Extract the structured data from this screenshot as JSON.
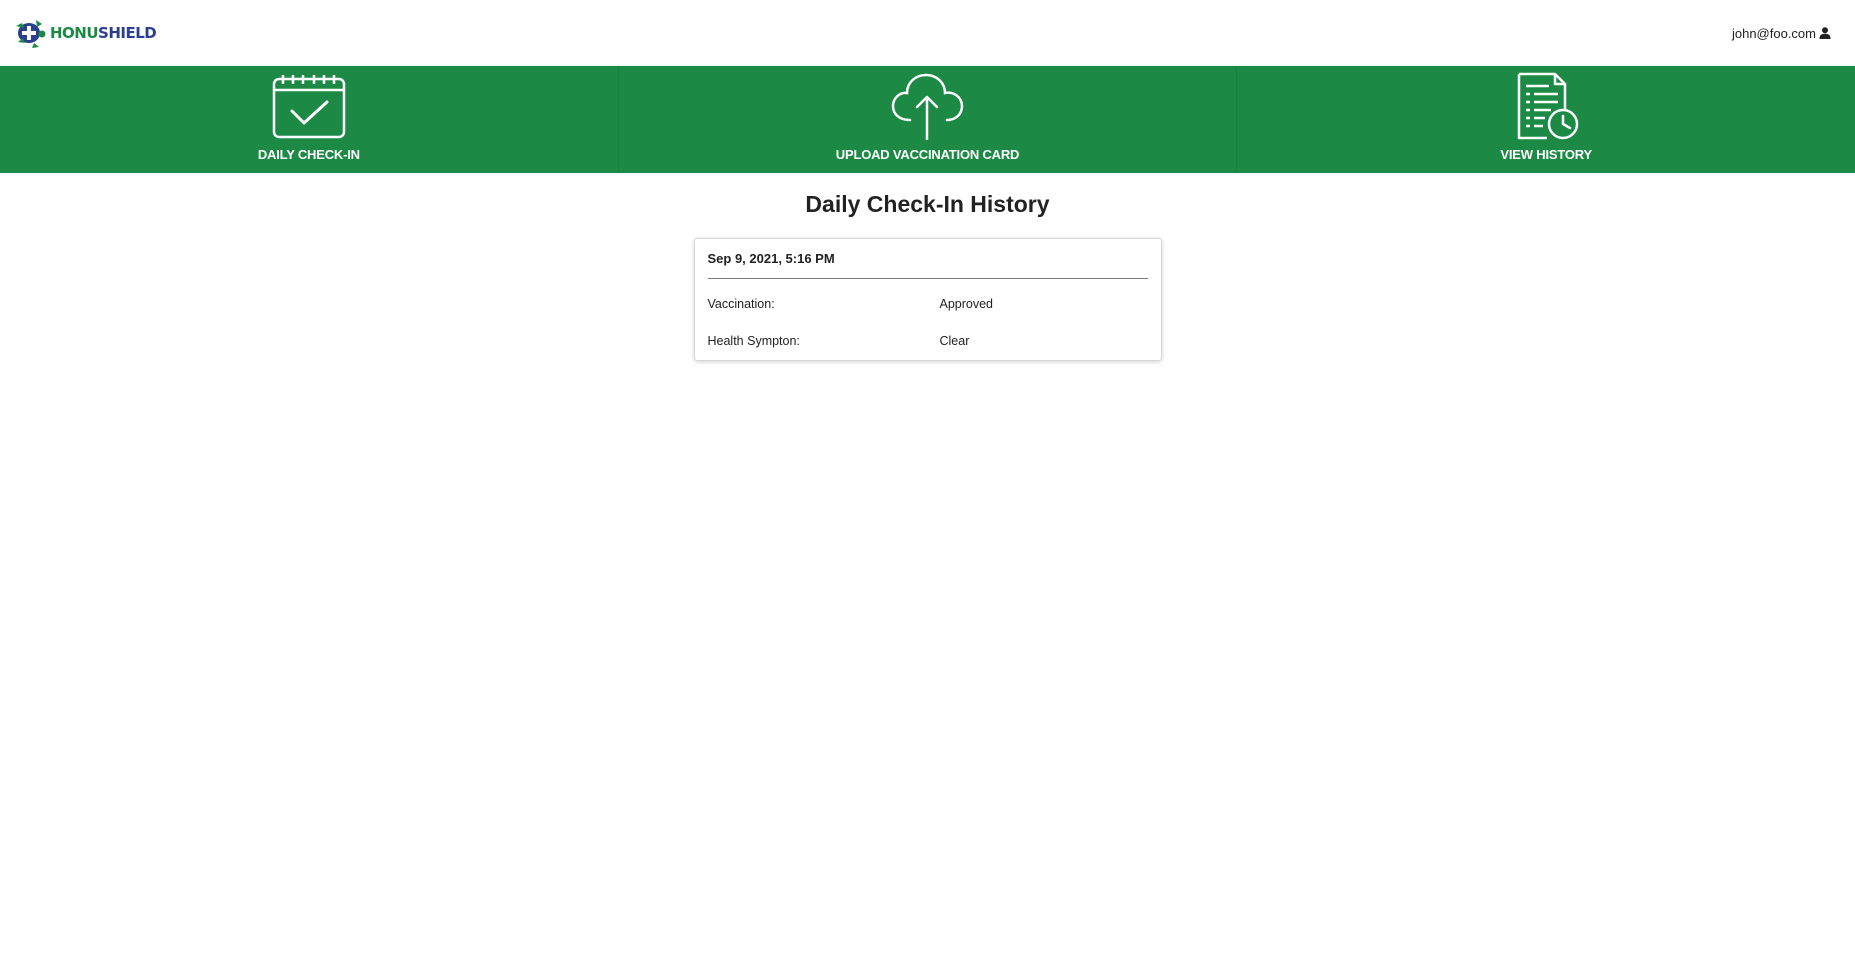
{
  "header": {
    "logo_part1": "HONU",
    "logo_part2": "SHIELD",
    "user_email": "john@foo.com"
  },
  "nav": {
    "items": [
      {
        "label": "DAILY CHECK-IN",
        "icon": "calendar-check-icon"
      },
      {
        "label": "UPLOAD VACCINATION CARD",
        "icon": "cloud-upload-icon"
      },
      {
        "label": "VIEW HISTORY",
        "icon": "document-clock-icon"
      }
    ]
  },
  "main": {
    "title": "Daily Check-In History",
    "entries": [
      {
        "date": "Sep 9, 2021, 5:16 PM",
        "rows": [
          {
            "label": "Vaccination:",
            "value": "Approved"
          },
          {
            "label": "Health Sympton:",
            "value": "Clear"
          }
        ]
      }
    ]
  },
  "colors": {
    "brand_green": "#1c8a45",
    "brand_blue": "#2a3f8f",
    "text": "#222222"
  }
}
